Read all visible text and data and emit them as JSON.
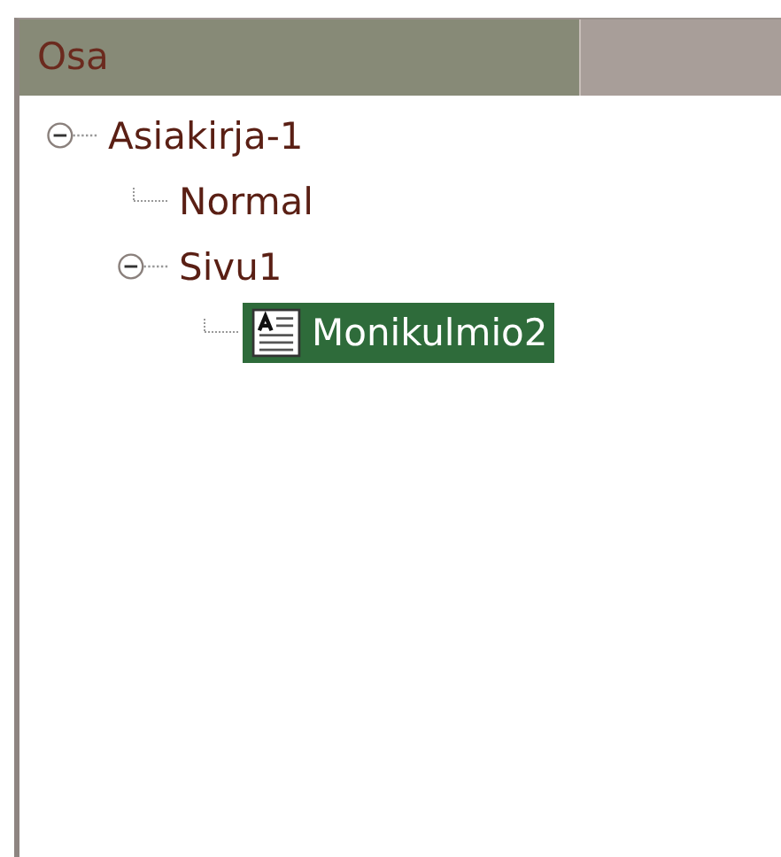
{
  "tree": {
    "column_header": "Osa",
    "items": [
      {
        "label": "Asiakirja-1",
        "expanded": true,
        "selected": false,
        "children": [
          {
            "label": "Normal",
            "selected": false
          },
          {
            "label": "Sivu1",
            "expanded": true,
            "selected": false,
            "children": [
              {
                "label": "Monikulmio2",
                "kind": "text-object",
                "selected": true
              }
            ]
          }
        ]
      }
    ]
  }
}
